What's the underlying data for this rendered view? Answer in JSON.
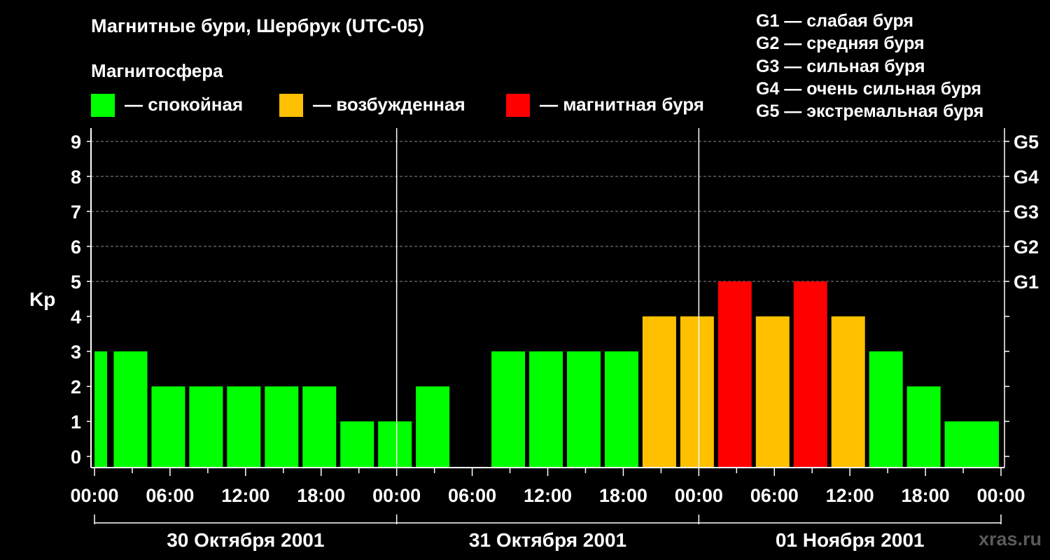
{
  "title": "Магнитные бури, Шербрук (UTC-05)",
  "subtitle": "Магнитосфера",
  "legend": [
    {
      "label": "— спокойная",
      "color": "#00ff00"
    },
    {
      "label": "— возбужденная",
      "color": "#ffc000"
    },
    {
      "label": "— магнитная буря",
      "color": "#ff0000"
    }
  ],
  "g_scale": [
    "G1 — слабая буря",
    "G2 — средняя буря",
    "G3 — сильная буря",
    "G4 — очень сильная буря",
    "G5 — экстремальная буря"
  ],
  "watermark": "xras.ru",
  "chart_data": {
    "type": "bar",
    "ylabel": "Kp",
    "ylim": [
      0,
      9
    ],
    "yticks": [
      "0",
      "1",
      "2",
      "3",
      "4",
      "5",
      "6",
      "7",
      "8",
      "9"
    ],
    "right_ticks": [
      {
        "value": 5,
        "label": "G1"
      },
      {
        "value": 6,
        "label": "G2"
      },
      {
        "value": 7,
        "label": "G3"
      },
      {
        "value": 8,
        "label": "G4"
      },
      {
        "value": 9,
        "label": "G5"
      }
    ],
    "grid": "horizontal dashed at 5-9",
    "xticks": [
      "00:00",
      "06:00",
      "12:00",
      "18:00",
      "00:00",
      "06:00",
      "12:00",
      "18:00",
      "00:00",
      "06:00",
      "12:00",
      "18:00",
      "00:00"
    ],
    "dates": [
      "30 Октября 2001",
      "31 Октября 2001",
      "01 Ноября 2001"
    ],
    "interval_hours": 3,
    "colors": {
      "quiet": "#00ff00",
      "active": "#ffc000",
      "storm": "#ff0000"
    },
    "bars": [
      {
        "start": "30 Окт 00:00",
        "kp": 3,
        "level": "quiet",
        "partial": true
      },
      {
        "start": "30 Окт 00:00",
        "kp": 3,
        "level": "quiet"
      },
      {
        "start": "30 Окт 03:00",
        "kp": 2,
        "level": "quiet"
      },
      {
        "start": "30 Окт 06:00",
        "kp": 2,
        "level": "quiet"
      },
      {
        "start": "30 Окт 09:00",
        "kp": 2,
        "level": "quiet"
      },
      {
        "start": "30 Окт 12:00",
        "kp": 2,
        "level": "quiet"
      },
      {
        "start": "30 Окт 15:00",
        "kp": 2,
        "level": "quiet"
      },
      {
        "start": "30 Окт 18:00",
        "kp": 1,
        "level": "quiet"
      },
      {
        "start": "30 Окт 21:00",
        "kp": 1,
        "level": "quiet"
      },
      {
        "start": "31 Окт 00:00",
        "kp": 2,
        "level": "quiet"
      },
      {
        "start": "31 Окт 03:00",
        "kp": 0,
        "level": "quiet"
      },
      {
        "start": "31 Окт 06:00",
        "kp": 3,
        "level": "quiet"
      },
      {
        "start": "31 Окт 09:00",
        "kp": 3,
        "level": "quiet"
      },
      {
        "start": "31 Окт 12:00",
        "kp": 3,
        "level": "quiet"
      },
      {
        "start": "31 Окт 15:00",
        "kp": 3,
        "level": "quiet"
      },
      {
        "start": "31 Окт 18:00",
        "kp": 4,
        "level": "active"
      },
      {
        "start": "31 Окт 21:00",
        "kp": 4,
        "level": "active"
      },
      {
        "start": "01 Ноя 00:00",
        "kp": 5,
        "level": "storm"
      },
      {
        "start": "01 Ноя 03:00",
        "kp": 4,
        "level": "active"
      },
      {
        "start": "01 Ноя 06:00",
        "kp": 5,
        "level": "storm"
      },
      {
        "start": "01 Ноя 09:00",
        "kp": 4,
        "level": "active"
      },
      {
        "start": "01 Ноя 12:00",
        "kp": 3,
        "level": "quiet"
      },
      {
        "start": "01 Ноя 15:00",
        "kp": 2,
        "level": "quiet"
      },
      {
        "start": "01 Ноя 18:00",
        "kp": 1,
        "level": "quiet"
      },
      {
        "start": "01 Ноя 21:00",
        "kp": 1,
        "level": "quiet",
        "partial": true
      }
    ]
  }
}
